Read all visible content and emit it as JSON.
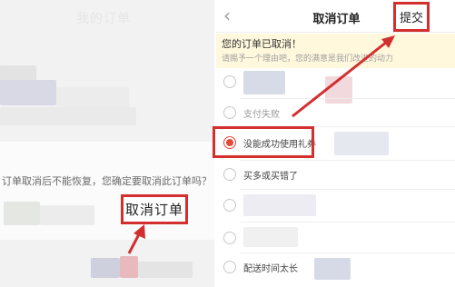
{
  "left_panel": {
    "title": "我的订单",
    "dialog": {
      "message": "订单取消后不能恢复，您确定要取消此订单吗？",
      "cancel_order_button": "取消订单"
    }
  },
  "right_panel": {
    "header": {
      "back_icon": "chevron-left-icon",
      "title": "取消订单",
      "submit_button": "提交"
    },
    "notice": {
      "title": "您的订单已取消！",
      "subtitle": "请赐予一个理由吧，您的满意是我们改进的动力"
    },
    "reasons": [
      {
        "label": "",
        "checked": false
      },
      {
        "label": "支付失败",
        "checked": false
      },
      {
        "label": "没能成功使用礼券",
        "checked": true
      },
      {
        "label": "买多或买错了",
        "checked": false
      },
      {
        "label": "",
        "checked": false
      },
      {
        "label": "",
        "checked": false
      },
      {
        "label": "配送时间太长",
        "checked": false
      }
    ]
  },
  "colors": {
    "highlight": "#d32f2f",
    "radio_selected": "#e24a3b",
    "notice_background": "#fff8dd"
  }
}
